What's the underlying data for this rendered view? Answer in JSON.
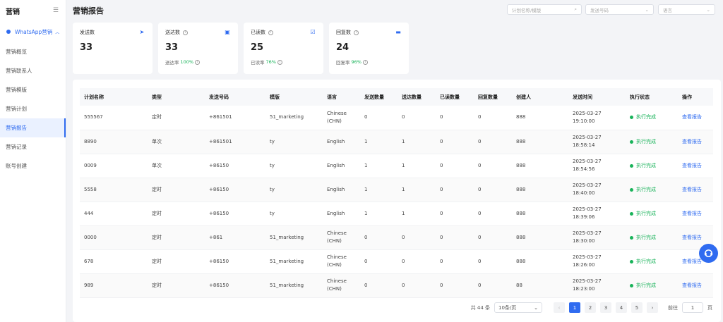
{
  "sidebar": {
    "title": "营销",
    "group": "WhatsApp营销",
    "items": [
      {
        "label": "营销概览"
      },
      {
        "label": "营销联系人"
      },
      {
        "label": "营销模版"
      },
      {
        "label": "营销计划"
      },
      {
        "label": "营销报告"
      },
      {
        "label": "营销记录"
      },
      {
        "label": "账号创建"
      }
    ]
  },
  "header": {
    "title": "营销报告",
    "search_placeholder": "计划名称/模版",
    "number_placeholder": "发送号码",
    "language_placeholder": "语言"
  },
  "cards": [
    {
      "label": "发送数",
      "value": "33",
      "sub_label": "",
      "sub_pct": ""
    },
    {
      "label": "送达数",
      "value": "33",
      "sub_label": "送达率",
      "sub_pct": "100%"
    },
    {
      "label": "已读数",
      "value": "25",
      "sub_label": "已读率",
      "sub_pct": "76%"
    },
    {
      "label": "回复数",
      "value": "24",
      "sub_label": "回复率",
      "sub_pct": "96%"
    }
  ],
  "table": {
    "headers": [
      "计划名称",
      "类型",
      "发送号码",
      "模版",
      "语言",
      "发送数量",
      "送达数量",
      "已读数量",
      "回复数量",
      "创建人",
      "发送时间",
      "执行状态",
      "操作"
    ],
    "rows": [
      {
        "name": "555567",
        "type": "定时",
        "phone": "+861501",
        "tpl": "51_marketing",
        "lang": "Chinese (CHN)",
        "sent": "0",
        "delivered": "0",
        "read": "0",
        "reply": "0",
        "creator": "888",
        "date": "2025-03-27",
        "time": "19:10:00",
        "status": "执行完成",
        "action": "查看报告"
      },
      {
        "name": "8890",
        "type": "单次",
        "phone": "+861501",
        "tpl": "ty",
        "lang": "English",
        "sent": "1",
        "delivered": "1",
        "read": "0",
        "reply": "0",
        "creator": "888",
        "date": "2025-03-27",
        "time": "18:58:14",
        "status": "执行完成",
        "action": "查看报告"
      },
      {
        "name": "0009",
        "type": "单次",
        "phone": "+86150",
        "tpl": "ty",
        "lang": "English",
        "sent": "1",
        "delivered": "1",
        "read": "0",
        "reply": "0",
        "creator": "888",
        "date": "2025-03-27",
        "time": "18:54:56",
        "status": "执行完成",
        "action": "查看报告"
      },
      {
        "name": "5558",
        "type": "定时",
        "phone": "+86150",
        "tpl": "ty",
        "lang": "English",
        "sent": "1",
        "delivered": "1",
        "read": "0",
        "reply": "0",
        "creator": "888",
        "date": "2025-03-27",
        "time": "18:40:00",
        "status": "执行完成",
        "action": "查看报告"
      },
      {
        "name": "444",
        "type": "定时",
        "phone": "+86150",
        "tpl": "ty",
        "lang": "English",
        "sent": "1",
        "delivered": "1",
        "read": "0",
        "reply": "0",
        "creator": "888",
        "date": "2025-03-27",
        "time": "18:39:06",
        "status": "执行完成",
        "action": "查看报告"
      },
      {
        "name": "0000",
        "type": "定时",
        "phone": "+861",
        "tpl": "51_marketing",
        "lang": "Chinese (CHN)",
        "sent": "0",
        "delivered": "0",
        "read": "0",
        "reply": "0",
        "creator": "888",
        "date": "2025-03-27",
        "time": "18:30:00",
        "status": "执行完成",
        "action": "查看报告"
      },
      {
        "name": "678",
        "type": "定时",
        "phone": "+86150",
        "tpl": "51_marketing",
        "lang": "Chinese (CHN)",
        "sent": "0",
        "delivered": "0",
        "read": "0",
        "reply": "0",
        "creator": "888",
        "date": "2025-03-27",
        "time": "18:26:00",
        "status": "执行完成",
        "action": "查看报告"
      },
      {
        "name": "989",
        "type": "定时",
        "phone": "+86150",
        "tpl": "51_marketing",
        "lang": "Chinese (CHN)",
        "sent": "0",
        "delivered": "0",
        "read": "0",
        "reply": "0",
        "creator": "88",
        "date": "2025-03-27",
        "time": "18:23:00",
        "status": "执行完成",
        "action": "查看报告"
      }
    ]
  },
  "pager": {
    "total": "共 44 条",
    "page_size": "10条/页",
    "pages": [
      "1",
      "2",
      "3",
      "4",
      "5"
    ],
    "current": "1",
    "goto_label": "前往",
    "goto_value": "1",
    "page_suffix": "页"
  },
  "colors": {
    "accent": "#2f6bf0",
    "success": "#19b35a"
  }
}
